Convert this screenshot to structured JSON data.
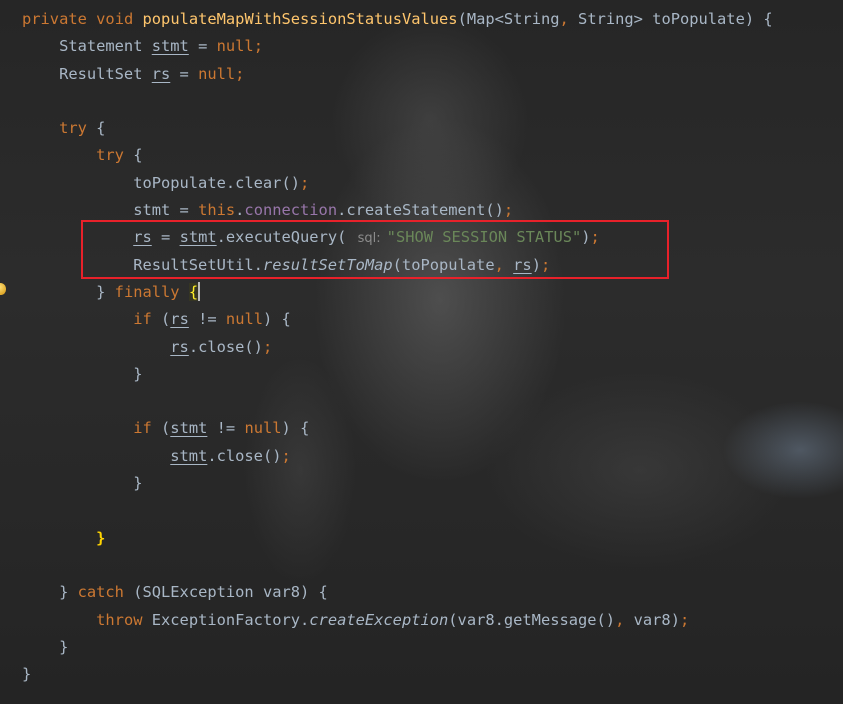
{
  "editor": {
    "language": "Java",
    "lines": [
      [
        [
          "kw",
          "private"
        ],
        [
          "p",
          " "
        ],
        [
          "kw",
          "void"
        ],
        [
          "p",
          " "
        ],
        [
          "fn",
          "populateMapWithSessionStatusValues"
        ],
        [
          "p",
          "(Map<String"
        ],
        [
          "kw",
          ","
        ],
        [
          "p",
          " String> toPopulate) {"
        ]
      ],
      [
        [
          "p",
          "    Statement "
        ],
        [
          "u",
          "stmt"
        ],
        [
          "p",
          " = "
        ],
        [
          "kw",
          "null"
        ],
        [
          "kw",
          ";"
        ]
      ],
      [
        [
          "p",
          "    ResultSet "
        ],
        [
          "u",
          "rs"
        ],
        [
          "p",
          " = "
        ],
        [
          "kw",
          "null"
        ],
        [
          "kw",
          ";"
        ]
      ],
      [],
      [
        [
          "p",
          "    "
        ],
        [
          "kw",
          "try"
        ],
        [
          "p",
          " {"
        ]
      ],
      [
        [
          "p",
          "        "
        ],
        [
          "kw",
          "try"
        ],
        [
          "p",
          " {"
        ]
      ],
      [
        [
          "p",
          "            toPopulate.clear()"
        ],
        [
          "kw",
          ";"
        ]
      ],
      [
        [
          "p",
          "            stmt = "
        ],
        [
          "kw",
          "this"
        ],
        [
          "p",
          "."
        ],
        [
          "field",
          "connection"
        ],
        [
          "p",
          ".createStatement()"
        ],
        [
          "kw",
          ";"
        ]
      ],
      [
        [
          "p",
          "            "
        ],
        [
          "u",
          "rs"
        ],
        [
          "p",
          " = "
        ],
        [
          "u",
          "stmt"
        ],
        [
          "p",
          ".executeQuery( "
        ],
        [
          "hint",
          "sql:"
        ],
        [
          "str",
          "\"SHOW SESSION STATUS\""
        ],
        [
          "p",
          ")"
        ],
        [
          "kw",
          ";"
        ]
      ],
      [
        [
          "p",
          "            ResultSetUtil."
        ],
        [
          "it",
          "resultSetToMap"
        ],
        [
          "p",
          "(toPopulate"
        ],
        [
          "kw",
          ","
        ],
        [
          "p",
          " "
        ],
        [
          "u",
          "rs"
        ],
        [
          "p",
          ")"
        ],
        [
          "kw",
          ";"
        ]
      ],
      [
        [
          "p",
          "        } "
        ],
        [
          "kw",
          "finally"
        ],
        [
          "p",
          " "
        ],
        [
          "bh",
          "{"
        ],
        [
          "caret",
          ""
        ]
      ],
      [
        [
          "p",
          "            "
        ],
        [
          "kw",
          "if"
        ],
        [
          "p",
          " ("
        ],
        [
          "u",
          "rs"
        ],
        [
          "p",
          " != "
        ],
        [
          "kw",
          "null"
        ],
        [
          "p",
          ") {"
        ]
      ],
      [
        [
          "p",
          "                "
        ],
        [
          "u",
          "rs"
        ],
        [
          "p",
          ".close()"
        ],
        [
          "kw",
          ";"
        ]
      ],
      [
        [
          "p",
          "            }"
        ]
      ],
      [],
      [
        [
          "p",
          "            "
        ],
        [
          "kw",
          "if"
        ],
        [
          "p",
          " ("
        ],
        [
          "u",
          "stmt"
        ],
        [
          "p",
          " != "
        ],
        [
          "kw",
          "null"
        ],
        [
          "p",
          ") {"
        ]
      ],
      [
        [
          "p",
          "                "
        ],
        [
          "u",
          "stmt"
        ],
        [
          "p",
          ".close()"
        ],
        [
          "kw",
          ";"
        ]
      ],
      [
        [
          "p",
          "            }"
        ]
      ],
      [],
      [
        [
          "p",
          "        "
        ],
        [
          "ba",
          "}"
        ]
      ],
      [],
      [
        [
          "p",
          "    } "
        ],
        [
          "kw",
          "catch"
        ],
        [
          "p",
          " (SQLException var8) {"
        ]
      ],
      [
        [
          "p",
          "        "
        ],
        [
          "kw",
          "throw"
        ],
        [
          "p",
          " ExceptionFactory."
        ],
        [
          "it",
          "createException"
        ],
        [
          "p",
          "(var8.getMessage()"
        ],
        [
          "kw",
          ","
        ],
        [
          "p",
          " var8)"
        ],
        [
          "kw",
          ";"
        ]
      ],
      [
        [
          "p",
          "    }"
        ]
      ],
      [
        [
          "p",
          "}"
        ]
      ]
    ]
  },
  "annotations": {
    "highlight_box_color": "#e8212a"
  },
  "icons": {
    "gutter": "intention-bulb-icon"
  }
}
